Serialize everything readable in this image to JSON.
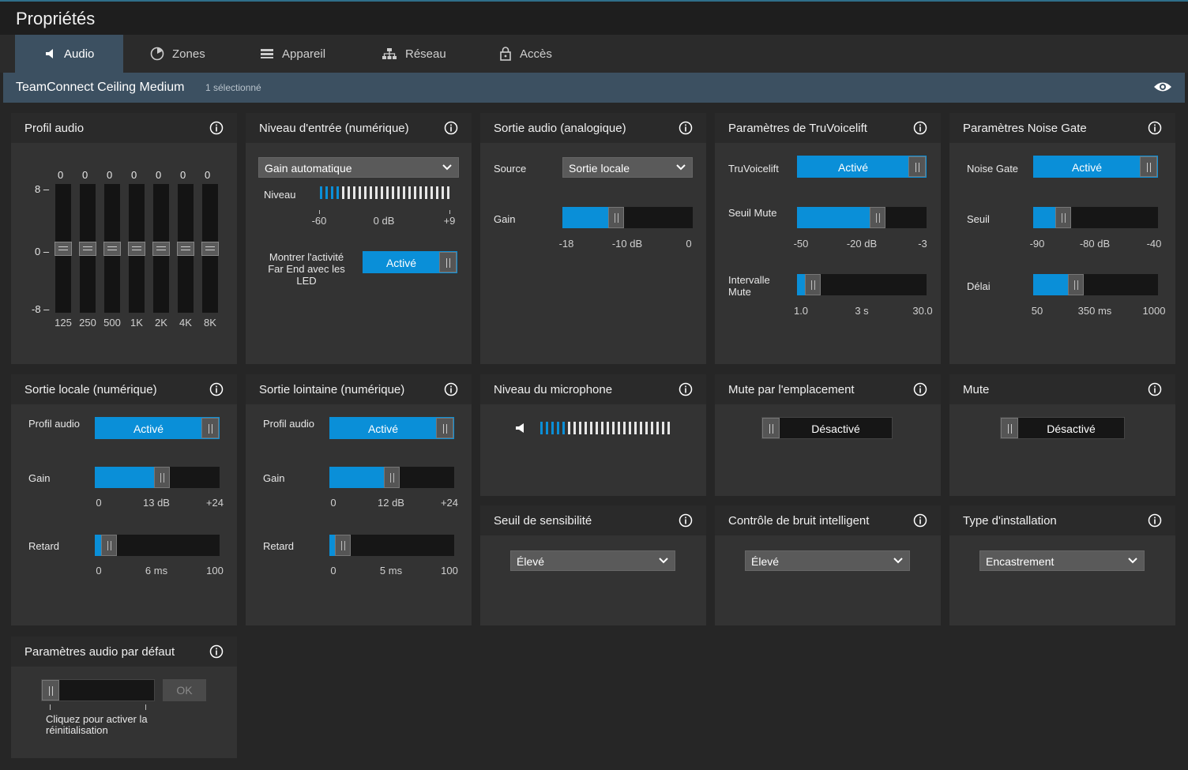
{
  "window": {
    "title": "Propriétés"
  },
  "tabs": [
    {
      "label": "Audio",
      "icon": "speaker-icon"
    },
    {
      "label": "Zones",
      "icon": "zones-icon"
    },
    {
      "label": "Appareil",
      "icon": "device-icon"
    },
    {
      "label": "Réseau",
      "icon": "network-icon"
    },
    {
      "label": "Accès",
      "icon": "lock-icon"
    }
  ],
  "device": {
    "name": "TeamConnect Ceiling Medium",
    "selected": "1 sélectionné"
  },
  "profil_audio": {
    "title": "Profil audio",
    "bands": [
      "125",
      "250",
      "500",
      "1K",
      "2K",
      "4K",
      "8K"
    ],
    "values": [
      "0",
      "0",
      "0",
      "0",
      "0",
      "0",
      "0"
    ],
    "scale": [
      "8 –",
      "0 –",
      "-8 –"
    ]
  },
  "niveau_entree": {
    "title": "Niveau d'entrée (numérique)",
    "mode": "Gain automatique",
    "niveau_label": "Niveau",
    "ticks": [
      "-60",
      "0 dB",
      "+9"
    ],
    "led_label": "Montrer l'activité Far End avec les LED",
    "led_state": "Activé"
  },
  "sortie_audio": {
    "title": "Sortie audio (analogique)",
    "source_label": "Source",
    "source_value": "Sortie locale",
    "gain_label": "Gain",
    "gain_ticks": [
      "-18",
      "-10 dB",
      "0"
    ],
    "gain_fraction": 0.4
  },
  "truvoicelift": {
    "title": "Paramètres de TruVoicelift",
    "tvl_label": "TruVoicelift",
    "tvl_state": "Activé",
    "seuil_label": "Seuil Mute",
    "seuil_ticks": [
      "-50",
      "-20 dB",
      "-3"
    ],
    "seuil_fraction": 0.64,
    "intervalle_label": "Intervalle Mute",
    "intervalle_ticks": [
      "1.0",
      "3 s",
      "30.0"
    ],
    "intervalle_fraction": 0.07
  },
  "noise_gate": {
    "title": "Paramètres Noise Gate",
    "ng_label": "Noise Gate",
    "ng_state": "Activé",
    "seuil_label": "Seuil",
    "seuil_ticks": [
      "-90",
      "-80 dB",
      "-40"
    ],
    "seuil_fraction": 0.2,
    "delai_label": "Délai",
    "delai_ticks": [
      "50",
      "350 ms",
      "1000"
    ],
    "delai_fraction": 0.32
  },
  "sortie_locale": {
    "title": "Sortie locale (numérique)",
    "profil_label": "Profil audio",
    "profil_state": "Activé",
    "gain_label": "Gain",
    "gain_ticks": [
      "0",
      "13 dB",
      "+24"
    ],
    "gain_fraction": 0.54,
    "retard_label": "Retard",
    "retard_ticks": [
      "0",
      "6 ms",
      "100"
    ],
    "retard_fraction": 0.06
  },
  "sortie_lointaine": {
    "title": "Sortie lointaine (numérique)",
    "profil_label": "Profil audio",
    "profil_state": "Activé",
    "gain_label": "Gain",
    "gain_ticks": [
      "0",
      "12 dB",
      "+24"
    ],
    "gain_fraction": 0.5,
    "retard_label": "Retard",
    "retard_ticks": [
      "0",
      "5 ms",
      "100"
    ],
    "retard_fraction": 0.05
  },
  "niveau_micro": {
    "title": "Niveau du microphone"
  },
  "mute_emplacement": {
    "title": "Mute par l'emplacement",
    "state": "Désactivé"
  },
  "mute": {
    "title": "Mute",
    "state": "Désactivé"
  },
  "seuil_sensibilite": {
    "title": "Seuil de sensibilité",
    "value": "Élevé"
  },
  "controle_bruit": {
    "title": "Contrôle de bruit intelligent",
    "value": "Élevé"
  },
  "type_installation": {
    "title": "Type d'installation",
    "value": "Encastrement"
  },
  "defaut": {
    "title": "Paramètres audio par défaut",
    "ok_label": "OK",
    "hint": "Cliquez pour activer la réinitialisation"
  },
  "colors": {
    "accent": "#0a8fd8",
    "panel": "#333333",
    "header": "#2a2a2a",
    "device_bar": "#3c5061"
  }
}
